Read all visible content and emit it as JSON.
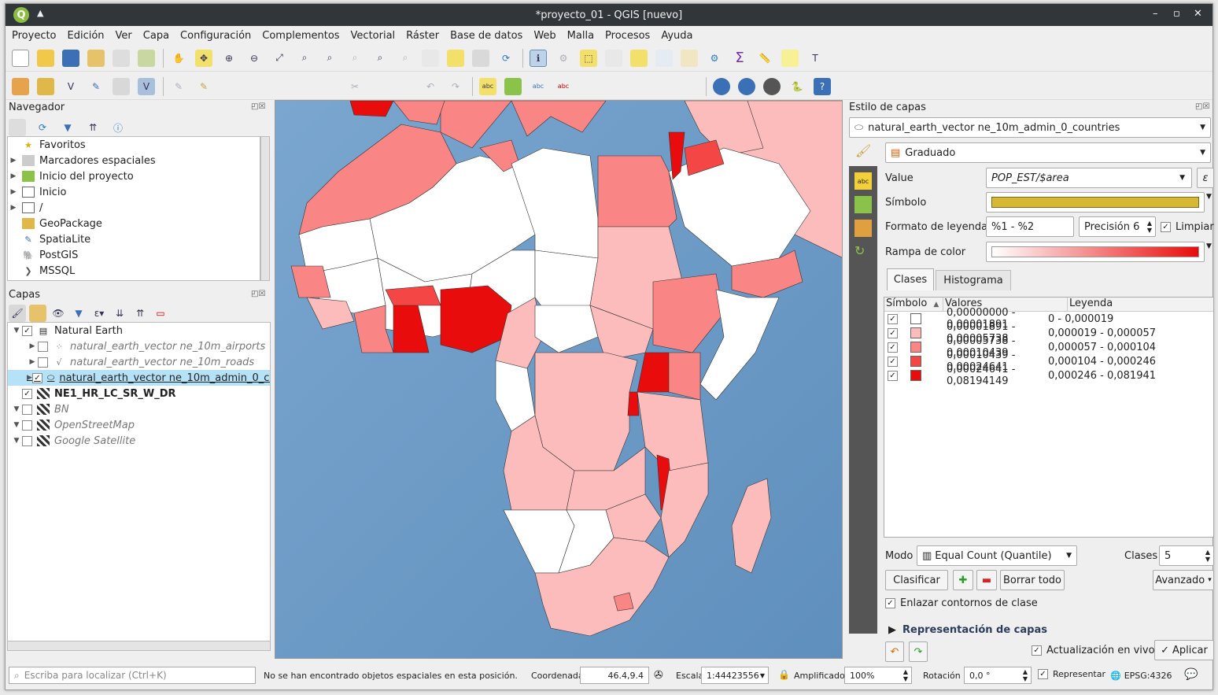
{
  "window": {
    "title": "*proyecto_01 - QGIS [nuevo]",
    "minimize": "–",
    "maximize": "▫",
    "close": "✕"
  },
  "menu": [
    "Proyecto",
    "Edición",
    "Ver",
    "Capa",
    "Configuración",
    "Complementos",
    "Vectorial",
    "Ráster",
    "Base de datos",
    "Web",
    "Malla",
    "Procesos",
    "Ayuda"
  ],
  "navigator": {
    "title": "Navegador",
    "items": [
      {
        "label": "Favoritos",
        "icon": "star-icon",
        "expand": ""
      },
      {
        "label": "Marcadores espaciales",
        "icon": "bookmark-icon",
        "expand": "▶"
      },
      {
        "label": "Inicio del proyecto",
        "icon": "project-home-icon",
        "expand": "▶"
      },
      {
        "label": "Inicio",
        "icon": "folder-icon",
        "expand": "▶"
      },
      {
        "label": "/",
        "icon": "folder-icon",
        "expand": "▶"
      },
      {
        "label": "GeoPackage",
        "icon": "geopackage-icon",
        "expand": ""
      },
      {
        "label": "SpatiaLite",
        "icon": "spatialite-icon",
        "expand": ""
      },
      {
        "label": "PostGIS",
        "icon": "postgis-icon",
        "expand": ""
      },
      {
        "label": "MSSQL",
        "icon": "mssql-icon",
        "expand": ""
      }
    ]
  },
  "layers": {
    "title": "Capas",
    "items": [
      {
        "label": "Natural Earth",
        "indent": 0,
        "checked": "✓",
        "expand": "▼",
        "style": "normal"
      },
      {
        "label": "natural_earth_vector ne_10m_airports",
        "indent": 1,
        "checked": "",
        "expand": "▶",
        "style": "italic-gray"
      },
      {
        "label": "natural_earth_vector ne_10m_roads",
        "indent": 1,
        "checked": "",
        "expand": "▶",
        "style": "italic-gray"
      },
      {
        "label": "natural_earth_vector ne_10m_admin_0_countries",
        "indent": 1,
        "checked": "✓",
        "expand": "▶",
        "style": "selected"
      },
      {
        "label": "NE1_HR_LC_SR_W_DR",
        "indent": 0,
        "checked": "✓",
        "expand": "",
        "style": "bold"
      },
      {
        "label": "BN",
        "indent": 0,
        "checked": "",
        "expand": "▼",
        "style": "italic-gray"
      },
      {
        "label": "OpenStreetMap",
        "indent": 0,
        "checked": "",
        "expand": "▼",
        "style": "italic-gray"
      },
      {
        "label": "Google Satellite",
        "indent": 0,
        "checked": "",
        "expand": "▼",
        "style": "italic-gray"
      }
    ]
  },
  "style_panel": {
    "title": "Estilo de capas",
    "layer": "natural_earth_vector ne_10m_admin_0_countries",
    "renderer": "Graduado",
    "value_label": "Value",
    "value": "POP_EST/$area",
    "symbol_label": "Símbolo",
    "legend_format_label": "Formato de leyenda",
    "legend_format": "%1 - %2",
    "precision": "Precisión 6",
    "trim": "Limpiar",
    "ramp_label": "Rampa de color",
    "tabs": [
      "Clases",
      "Histograma"
    ],
    "headers": [
      "Símbolo",
      "Valores",
      "Leyenda"
    ],
    "classes": [
      {
        "color": "#ffffff",
        "values": "0,00000000 - 0,00001891",
        "legend": "0 - 0,000019"
      },
      {
        "color": "#fcbcbc",
        "values": "0,00001891 - 0,00005738",
        "legend": "0,000019 - 0,000057"
      },
      {
        "color": "#f98585",
        "values": "0,00005738 - 0,00010439",
        "legend": "0,000057 - 0,000104"
      },
      {
        "color": "#f54646",
        "values": "0,00010439 - 0,00024641",
        "legend": "0,000104 - 0,000246"
      },
      {
        "color": "#e80c0c",
        "values": "0,00024641 - 0,08194149",
        "legend": "0,000246 - 0,081941"
      }
    ],
    "mode_label": "Modo",
    "mode": "Equal Count (Quantile)",
    "classes_label": "Clases",
    "classes_count": "5",
    "classify": "Clasificar",
    "delete_all": "Borrar todo",
    "advanced": "Avanzado",
    "link_contours": "Enlazar contornos de clase",
    "layer_rendering": "Representación de capas",
    "live_update": "Actualización en vivo",
    "apply": "Aplicar"
  },
  "status": {
    "locate_placeholder": "Escriba para localizar (Ctrl+K)",
    "message": "No se han encontrado objetos espaciales en esta posición.",
    "coord_label": "Coordenada",
    "coord": "46.4,9.4",
    "scale_label": "Escala",
    "scale": "1:44423556",
    "magnifier_label": "Amplificador",
    "magnifier": "100%",
    "rotation_label": "Rotación",
    "rotation": "0,0 °",
    "render": "Representar",
    "crs": "EPSG:4326"
  },
  "colors": {
    "c0": "#ffffff",
    "c1": "#fcbcbc",
    "c2": "#f98585",
    "c3": "#f54646",
    "c4": "#e80c0c",
    "sea": "#6d9cc6"
  }
}
